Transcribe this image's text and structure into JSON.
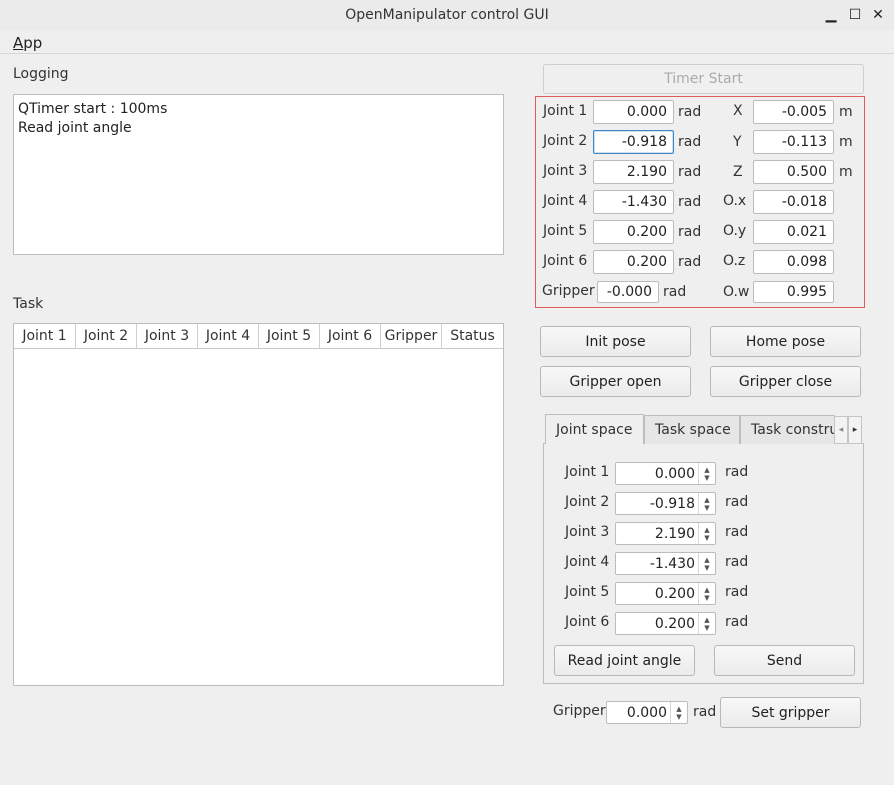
{
  "window": {
    "title": "OpenManipulator control GUI",
    "minimize_label": "▁",
    "maximize_label": "☐",
    "close_label": "✕"
  },
  "menu": {
    "app_mnemonic": "A",
    "app_rest": "pp"
  },
  "logging": {
    "label": "Logging",
    "lines": [
      "QTimer start : 100ms",
      "Read joint angle"
    ]
  },
  "task": {
    "label": "Task",
    "columns": [
      "Joint 1",
      "Joint 2",
      "Joint 3",
      "Joint 4",
      "Joint 5",
      "Joint 6",
      "Gripper",
      "Status"
    ]
  },
  "timer_button": "Timer Start",
  "status": {
    "joints": [
      {
        "label": "Joint 1",
        "value": "0.000",
        "unit": "rad"
      },
      {
        "label": "Joint 2",
        "value": "-0.918",
        "unit": "rad"
      },
      {
        "label": "Joint 3",
        "value": "2.190",
        "unit": "rad"
      },
      {
        "label": "Joint 4",
        "value": "-1.430",
        "unit": "rad"
      },
      {
        "label": "Joint 5",
        "value": "0.200",
        "unit": "rad"
      },
      {
        "label": "Joint 6",
        "value": "0.200",
        "unit": "rad"
      }
    ],
    "gripper": {
      "label": "Gripper",
      "value": "-0.000",
      "unit": "rad"
    },
    "pose": [
      {
        "label": "X",
        "value": "-0.005",
        "unit": "m"
      },
      {
        "label": "Y",
        "value": "-0.113",
        "unit": "m"
      },
      {
        "label": "Z",
        "value": "0.500",
        "unit": "m"
      },
      {
        "label": "O.x",
        "value": "-0.018",
        "unit": ""
      },
      {
        "label": "O.y",
        "value": "0.021",
        "unit": ""
      },
      {
        "label": "O.z",
        "value": "0.098",
        "unit": ""
      },
      {
        "label": "O.w",
        "value": "0.995",
        "unit": ""
      }
    ]
  },
  "buttons": {
    "init_pose": "Init pose",
    "home_pose": "Home pose",
    "gripper_open": "Gripper open",
    "gripper_close": "Gripper close"
  },
  "tabs": {
    "items": [
      "Joint space",
      "Task space",
      "Task constru"
    ],
    "scroll_left": "◂",
    "scroll_right": "▸"
  },
  "joint_space": {
    "rows": [
      {
        "label": "Joint 1",
        "value": "0.000",
        "unit": "rad"
      },
      {
        "label": "Joint 2",
        "value": "-0.918",
        "unit": "rad"
      },
      {
        "label": "Joint 3",
        "value": "2.190",
        "unit": "rad"
      },
      {
        "label": "Joint 4",
        "value": "-1.430",
        "unit": "rad"
      },
      {
        "label": "Joint 5",
        "value": "0.200",
        "unit": "rad"
      },
      {
        "label": "Joint 6",
        "value": "0.200",
        "unit": "rad"
      }
    ],
    "read_button": "Read joint angle",
    "send_button": "Send"
  },
  "gripper_control": {
    "label": "Gripper",
    "value": "0.000",
    "unit": "rad",
    "set_button": "Set gripper"
  },
  "spin_up": "▲",
  "spin_down": "▼"
}
